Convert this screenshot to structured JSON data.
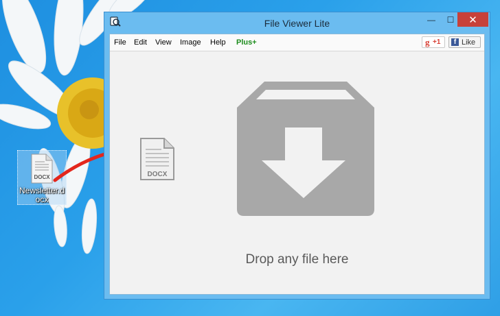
{
  "desktop": {
    "file_name": "Newsletter.docx",
    "file_badge": "DOCX"
  },
  "window": {
    "title": "File Viewer Lite",
    "controls": {
      "minimize": "—",
      "maximize": "☐",
      "close": "✕"
    }
  },
  "menu": {
    "file": "File",
    "edit": "Edit",
    "view": "View",
    "image": "Image",
    "help": "Help",
    "plus": "Plus+"
  },
  "social": {
    "gplus_g": "g",
    "gplus_count": "+1",
    "fb_f": "f",
    "fb_like": "Like"
  },
  "drop_area": {
    "message": "Drop any file here",
    "dragged_badge": "DOCX"
  },
  "colors": {
    "close_button": "#c7413a",
    "plus_label": "#1c8c1c",
    "drop_icon": "#a8a8a8",
    "arrow": "#e3261c"
  }
}
